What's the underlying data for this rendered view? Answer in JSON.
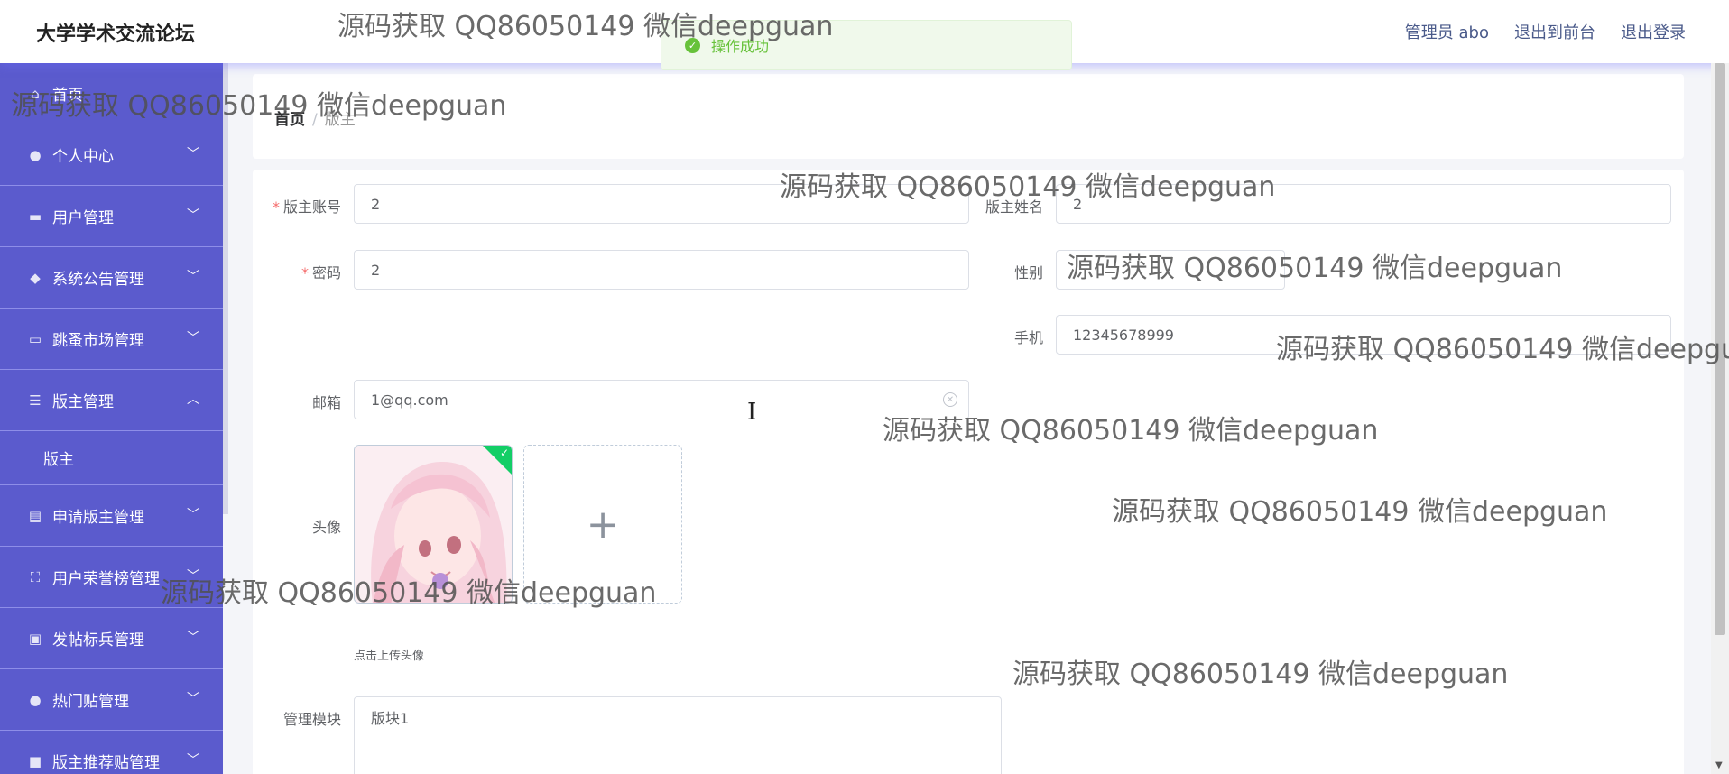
{
  "app": {
    "title": "大学学术交流论坛"
  },
  "header": {
    "admin": "管理员 abo",
    "to_front": "退出到前台",
    "logout": "退出登录"
  },
  "toast": {
    "message": "操作成功"
  },
  "sidebar": {
    "items": [
      {
        "label": "首页",
        "icon": "home-icon"
      },
      {
        "label": "个人中心",
        "icon": "user-icon"
      },
      {
        "label": "用户管理",
        "icon": "briefcase-icon"
      },
      {
        "label": "系统公告管理",
        "icon": "pin-icon"
      },
      {
        "label": "跳蚤市场管理",
        "icon": "chat-icon"
      },
      {
        "label": "版主管理",
        "icon": "sliders-icon",
        "expanded": true
      },
      {
        "label": "申请版主管理",
        "icon": "card-icon"
      },
      {
        "label": "用户荣誉榜管理",
        "icon": "frame-icon"
      },
      {
        "label": "发帖标兵管理",
        "icon": "clipboard-icon"
      },
      {
        "label": "热门贴管理",
        "icon": "bulb-icon"
      },
      {
        "label": "版主推荐贴管理",
        "icon": "monitor-icon"
      }
    ],
    "sub_item": "版主"
  },
  "breadcrumb": {
    "home": "首页",
    "sep": "/",
    "current": "版主"
  },
  "form": {
    "account_label": "版主账号",
    "account_value": "2",
    "name_label": "版主姓名",
    "name_value": "2",
    "password_label": "密码",
    "password_value": "2",
    "gender_label": "性别",
    "gender_value": "",
    "phone_label": "手机",
    "phone_value": "12345678999",
    "email_label": "邮箱",
    "email_value": "1@qq.com",
    "avatar_label": "头像",
    "upload_tip": "点击上传头像",
    "module_label": "管理模块",
    "module_value": "版块1"
  },
  "watermark": "源码获取 QQ86050149 微信deepguan",
  "colors": {
    "sidebar": "#5b5bcd",
    "toast_bg": "#f0f9eb",
    "toast_text": "#67c23a",
    "required": "#f56c6c"
  }
}
